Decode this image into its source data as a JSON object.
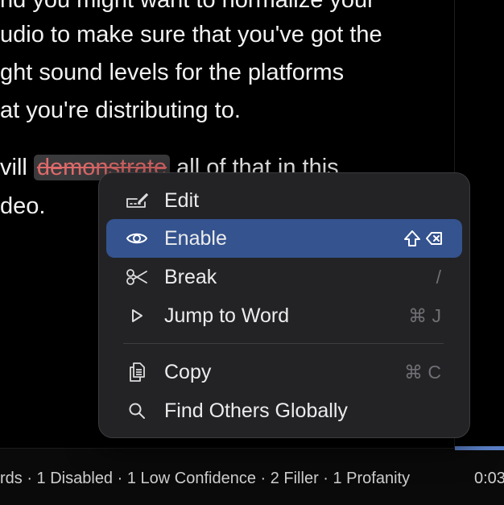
{
  "transcript": {
    "lines": [
      "nd you might want to normalize your",
      "udio to make sure that you've got the",
      "ght sound levels for the platforms",
      "at you're distributing to.",
      "deo."
    ],
    "line5_prefix": "vill ",
    "disabled_word": "demonstrate",
    "line5_suffix": " all of that in this"
  },
  "context_menu": {
    "items": [
      {
        "label": "Edit",
        "icon": "edit-icon",
        "shortcut": ""
      },
      {
        "label": "Enable",
        "icon": "eye-icon",
        "shortcut": "shift+delete",
        "selected": true
      },
      {
        "label": "Break",
        "icon": "scissors-icon",
        "shortcut": "/"
      },
      {
        "label": "Jump to Word",
        "icon": "play-triangle-icon",
        "shortcut": "⌘ J"
      },
      {
        "label": "Copy",
        "icon": "copy-icon",
        "shortcut": "⌘ C"
      },
      {
        "label": "Find Others Globally",
        "icon": "search-icon",
        "shortcut": ""
      }
    ]
  },
  "footer": {
    "stats": "rds · 1 Disabled · 1 Low Confidence · 2 Filler · 1 Profanity",
    "timecode": "0:03"
  },
  "colors": {
    "selection": "#34538f",
    "disabled_text": "#e06a6a",
    "progress": "#5b7fc7"
  }
}
